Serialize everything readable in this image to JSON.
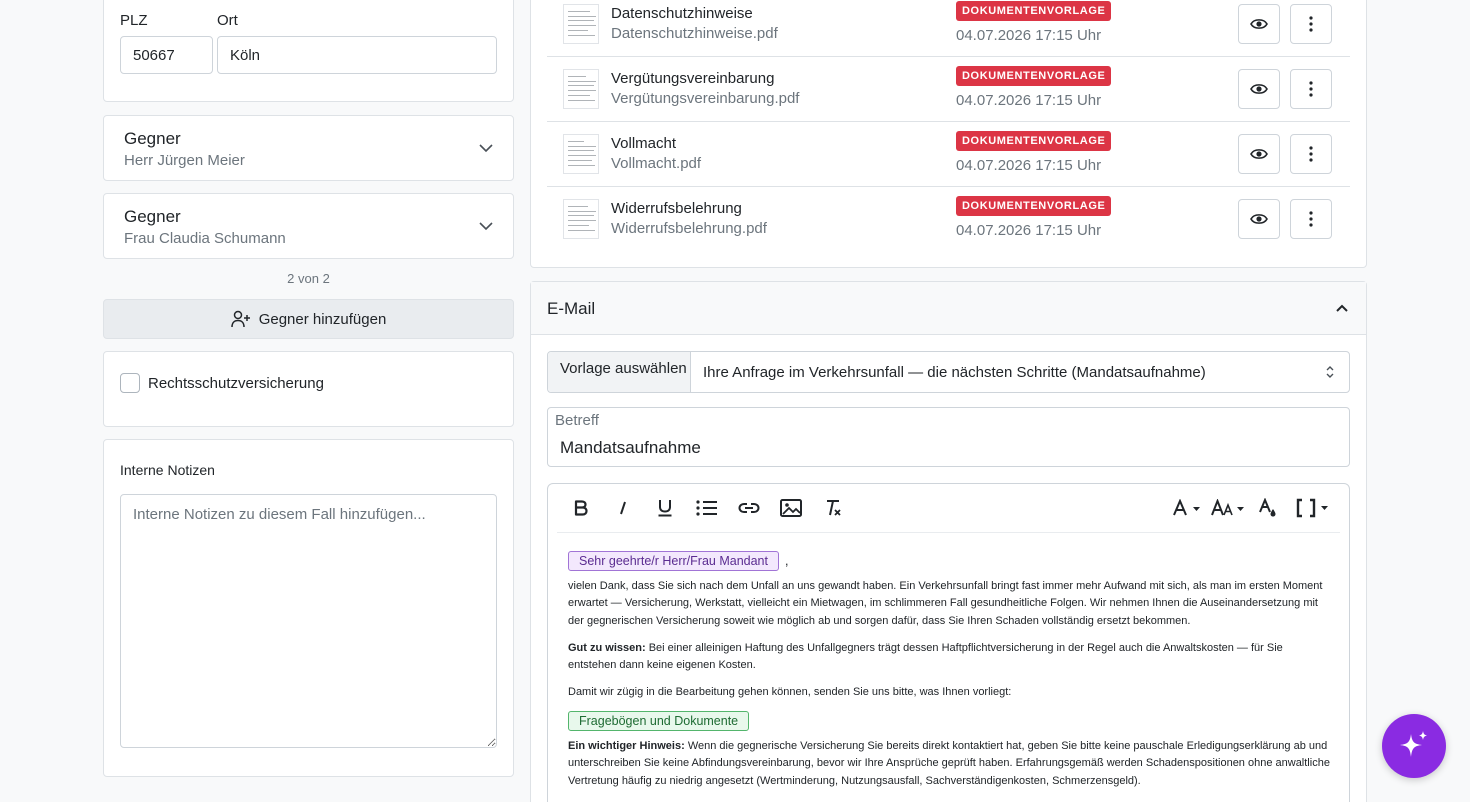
{
  "address": {
    "plz_label": "PLZ",
    "plz_value": "50667",
    "ort_label": "Ort",
    "ort_value": "Köln"
  },
  "opponents": [
    {
      "title": "Gegner",
      "name": "Herr Jürgen Meier"
    },
    {
      "title": "Gegner",
      "name": "Frau Claudia Schumann"
    }
  ],
  "opponent_counter": "2 von 2",
  "add_opponent_label": "Gegner hinzufügen",
  "legal_insurance_label": "Rechtsschutzversicherung",
  "notes": {
    "label": "Interne Notizen",
    "placeholder": "Interne Notizen zu diesem Fall hinzufügen..."
  },
  "documents": [
    {
      "name": "Datenschutzhinweise",
      "file": "Datenschutzhinweise.pdf",
      "badge": "DOKUMENTENVORLAGE",
      "date": "04.07.2026 17:15 Uhr"
    },
    {
      "name": "Vergütungsvereinbarung",
      "file": "Vergütungsvereinbarung.pdf",
      "badge": "DOKUMENTENVORLAGE",
      "date": "04.07.2026 17:15 Uhr"
    },
    {
      "name": "Vollmacht",
      "file": "Vollmacht.pdf",
      "badge": "DOKUMENTENVORLAGE",
      "date": "04.07.2026 17:15 Uhr"
    },
    {
      "name": "Widerrufsbelehrung",
      "file": "Widerrufsbelehrung.pdf",
      "badge": "DOKUMENTENVORLAGE",
      "date": "04.07.2026 17:15 Uhr"
    }
  ],
  "email": {
    "section_title": "E-Mail",
    "template_label": "Vorlage auswählen",
    "template_value": "Ihre Anfrage im Verkehrsunfall — die nächsten Schritte (Mandatsaufnahme)",
    "subject_label": "Betreff",
    "subject_value": "Mandatsaufnahme",
    "body": {
      "salutation_chip": "Sehr geehrte/r Herr/Frau Mandant",
      "salutation_suffix": ",",
      "p1": "vielen Dank, dass Sie sich nach dem Unfall an uns gewandt haben. Ein Verkehrsunfall bringt fast immer mehr Aufwand mit sich, als man im ersten Moment erwartet — Versicherung, Werkstatt, vielleicht ein Mietwagen, im schlimmeren Fall gesundheitliche Folgen. Wir nehmen Ihnen die Auseinandersetzung mit der gegnerischen Versicherung soweit wie möglich ab und sorgen dafür, dass Sie Ihren Schaden vollständig ersetzt bekommen.",
      "p2_bold": "Gut zu wissen:",
      "p2": "Bei einer alleinigen Haftung des Unfallgegners trägt dessen Haftpflichtversicherung in der Regel auch die Anwaltskosten — für Sie entstehen dann keine eigenen Kosten.",
      "p3": "Damit wir zügig in die Bearbeitung gehen können, senden Sie uns bitte, was Ihnen vorliegt:",
      "forms_chip": "Fragebögen und Dokumente",
      "p4_bold": "Ein wichtiger Hinweis:",
      "p4": "Wenn die gegnerische Versicherung Sie bereits direkt kontaktiert hat, geben Sie bitte keine pauschale Erledigungserklärung ab und unterschreiben Sie keine Abfindungsvereinbarung, bevor wir Ihre Ansprüche geprüft haben. Erfahrungsgemäß werden Schadenspositionen ohne anwaltliche Vertretung häufig zu niedrig angesetzt (Wertminderung, Nutzungsausfall, Sachverständigenkosten, Schmerzensgeld)."
    }
  },
  "colors": {
    "badge": "#dc3545",
    "fab": "#8a2be2",
    "chip_purple": "#a174d6",
    "chip_green": "#53b56c"
  }
}
